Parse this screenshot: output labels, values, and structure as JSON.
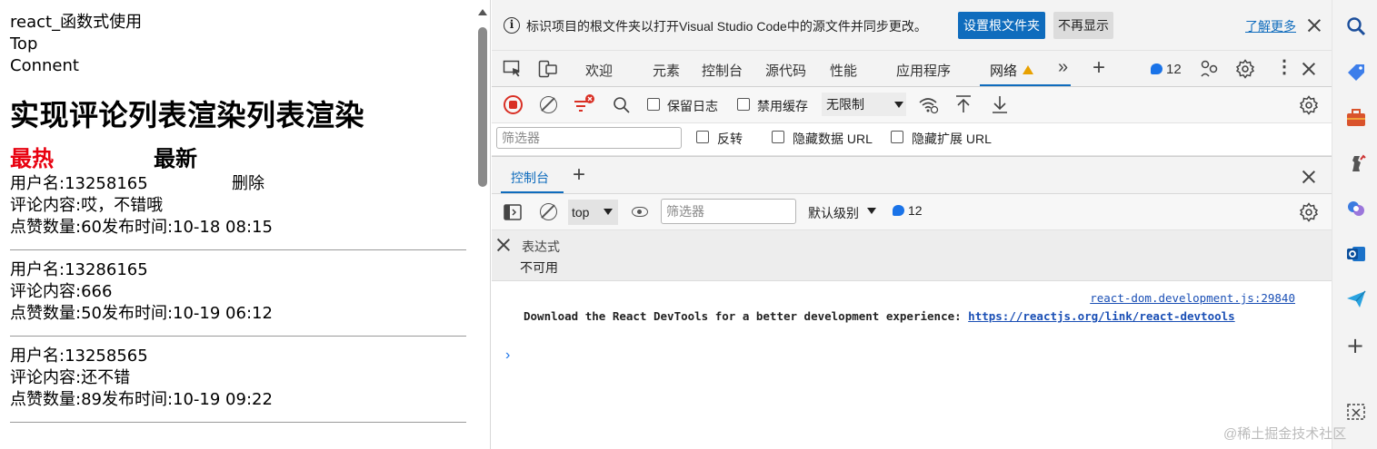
{
  "page": {
    "lines": [
      "react_函数式使用",
      "Top",
      "Connent"
    ],
    "heading": "实现评论列表渲染列表渲染",
    "tabs": {
      "hot": "最热",
      "new": "最新"
    },
    "comments": [
      {
        "user": "用户名:13258165",
        "delete": "删除",
        "content": "评论内容:哎，不错哦",
        "meta": "点赞数量:60发布时间:10-18 08:15"
      },
      {
        "user": "用户名:13286165",
        "content": "评论内容:666",
        "meta": "点赞数量:50发布时间:10-19 06:12"
      },
      {
        "user": "用户名:13258565",
        "content": "评论内容:还不错",
        "meta": "点赞数量:89发布时间:10-19 09:22"
      }
    ]
  },
  "devtools": {
    "infobar": {
      "text": "标识项目的根文件夹以打开Visual Studio Code中的源文件并同步更改。",
      "set_root": "设置根文件夹",
      "dismiss": "不再显示",
      "learn_more": "了解更多"
    },
    "tabs": [
      "欢迎",
      "元素",
      "控制台",
      "源代码",
      "性能",
      "应用程序",
      "网络"
    ],
    "active_tab": "网络",
    "issues_count": "12",
    "network": {
      "preserve_log": "保留日志",
      "disable_cache": "禁用缓存",
      "throttle": "无限制"
    },
    "filter": {
      "placeholder": "筛选器",
      "invert": "反转",
      "hide_data_url": "隐藏数据 URL",
      "hide_ext_url": "隐藏扩展 URL"
    },
    "drawer": {
      "tab": "控制台"
    },
    "console": {
      "context": "top",
      "filter_placeholder": "筛选器",
      "level": "默认级别",
      "issues": "12"
    },
    "expression": {
      "label": "表达式",
      "value": "不可用"
    },
    "output": {
      "source": "react-dom.development.js:29840",
      "message": "Download the React DevTools for a better development experience: ",
      "link": "https://reactjs.org/link/react-devtools"
    }
  },
  "watermark": "@稀土掘金技术社区",
  "colors": {
    "accent": "#0f6cbd",
    "hot": "#e8000f",
    "record": "#d93025"
  }
}
